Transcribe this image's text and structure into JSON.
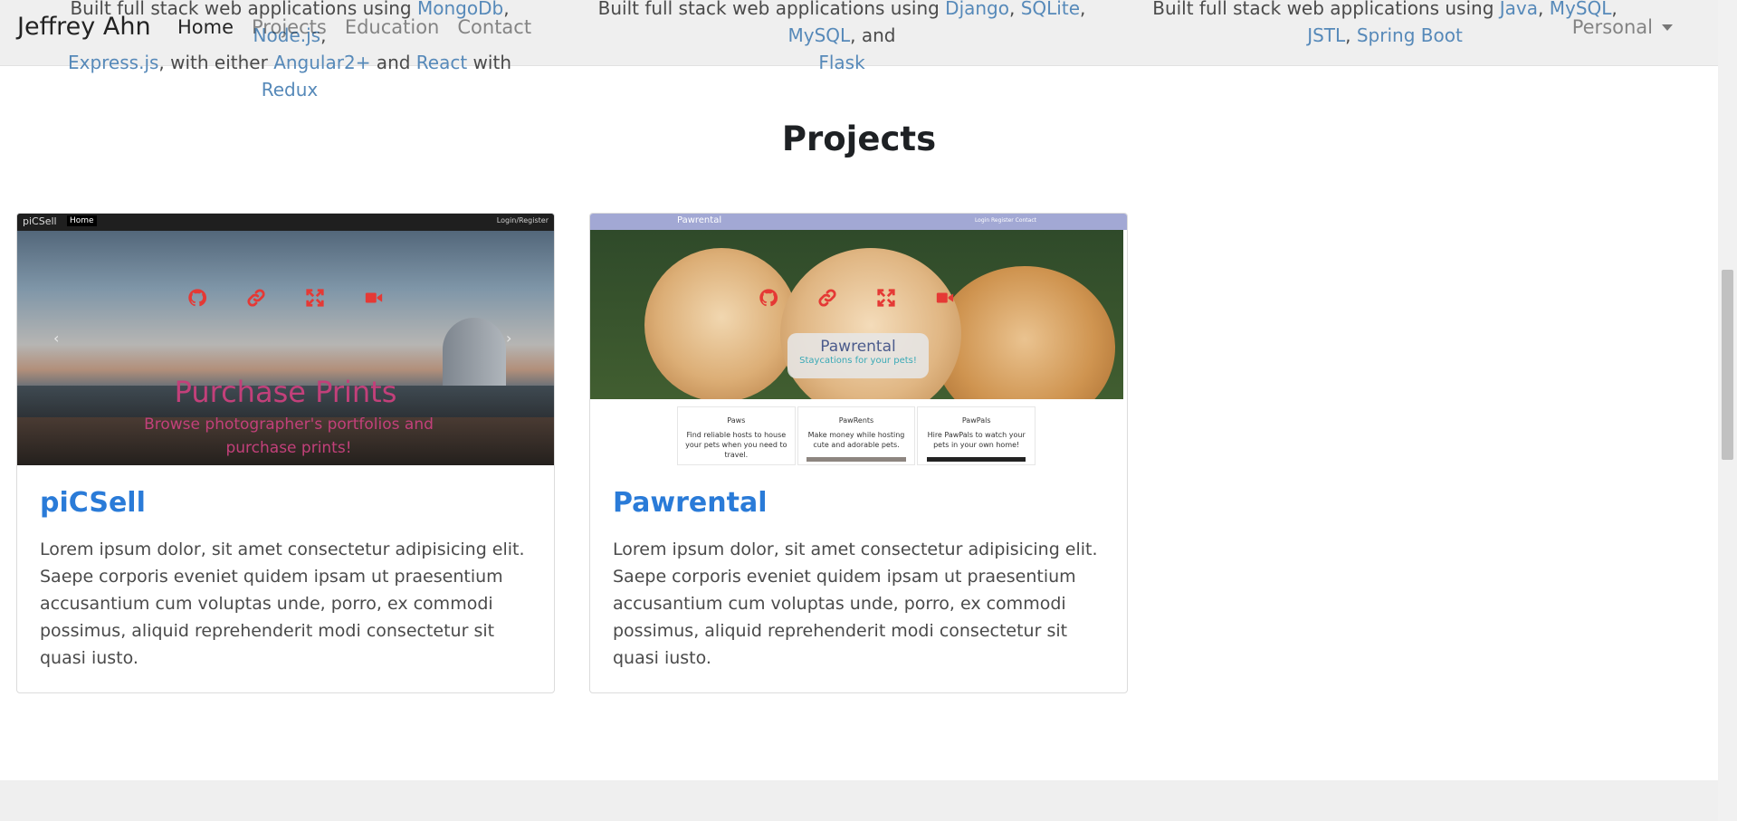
{
  "experience": {
    "col1": {
      "line_start": "Built full stack web applications using ",
      "tech": [
        "MongoDb",
        "Node.js",
        "Express.js",
        "Angular2+",
        "React",
        "Redux"
      ],
      "mid1": ", with either ",
      "and1": " and ",
      "with1": " with "
    },
    "col2": {
      "line_start": "Built full stack web applications using ",
      "tech": [
        "Django",
        "SQLite",
        "MySQL",
        "Flask"
      ],
      "and2": ", and"
    },
    "col3": {
      "line_start": "Built full stack web applications using ",
      "tech": [
        "Java",
        "MySQL",
        "JSTL",
        "Spring Boot"
      ]
    }
  },
  "navbar": {
    "brand": "Jeffrey Ahn",
    "links": [
      "Home",
      "Projects",
      "Education",
      "Contact"
    ],
    "active": "Home",
    "dropdown_label": "Personal"
  },
  "section": {
    "title": "Projects"
  },
  "projects": [
    {
      "title": "piCSell",
      "description": "Lorem ipsum dolor, sit amet consectetur adipisicing elit. Saepe corporis eveniet quidem ipsam ut praesentium accusantium cum voluptas unde, porro, ex commodi possimus, aliquid reprehenderit modi consectetur sit quasi iusto.",
      "screenshot": {
        "app_logo": "piCSell",
        "nav_home": "Home",
        "nav_login": "Login/Register",
        "caption_title": "Purchase Prints",
        "caption_subtitle": "Browse photographer's portfolios and purchase prints!"
      },
      "icons": [
        "github-icon",
        "link-icon",
        "expand-icon",
        "video-icon"
      ]
    },
    {
      "title": "Pawrental",
      "description": "Lorem ipsum dolor, sit amet consectetur adipisicing elit. Saepe corporis eveniet quidem ipsam ut praesentium accusantium cum voluptas unde, porro, ex commodi possimus, aliquid reprehenderit modi consectetur sit quasi iusto.",
      "screenshot": {
        "app_logo": "Pawrental",
        "nav_links": "Login   Register   Contact",
        "hero_title": "Pawrental",
        "hero_subtitle": "Staycations for your pets!",
        "features": [
          {
            "heading": "Paws",
            "text": "Find reliable hosts to house your pets when you need to travel."
          },
          {
            "heading": "PawRents",
            "text": "Make money while hosting cute and adorable pets."
          },
          {
            "heading": "PawPals",
            "text": "Hire PawPals to watch your pets in your own home!"
          }
        ]
      },
      "icons": [
        "github-icon",
        "link-icon",
        "expand-icon",
        "video-icon"
      ]
    }
  ],
  "colors": {
    "accent": "#2a7bd8",
    "icon_red": "#e53935",
    "link": "#5689b9",
    "caption_pink": "#c2407a"
  }
}
